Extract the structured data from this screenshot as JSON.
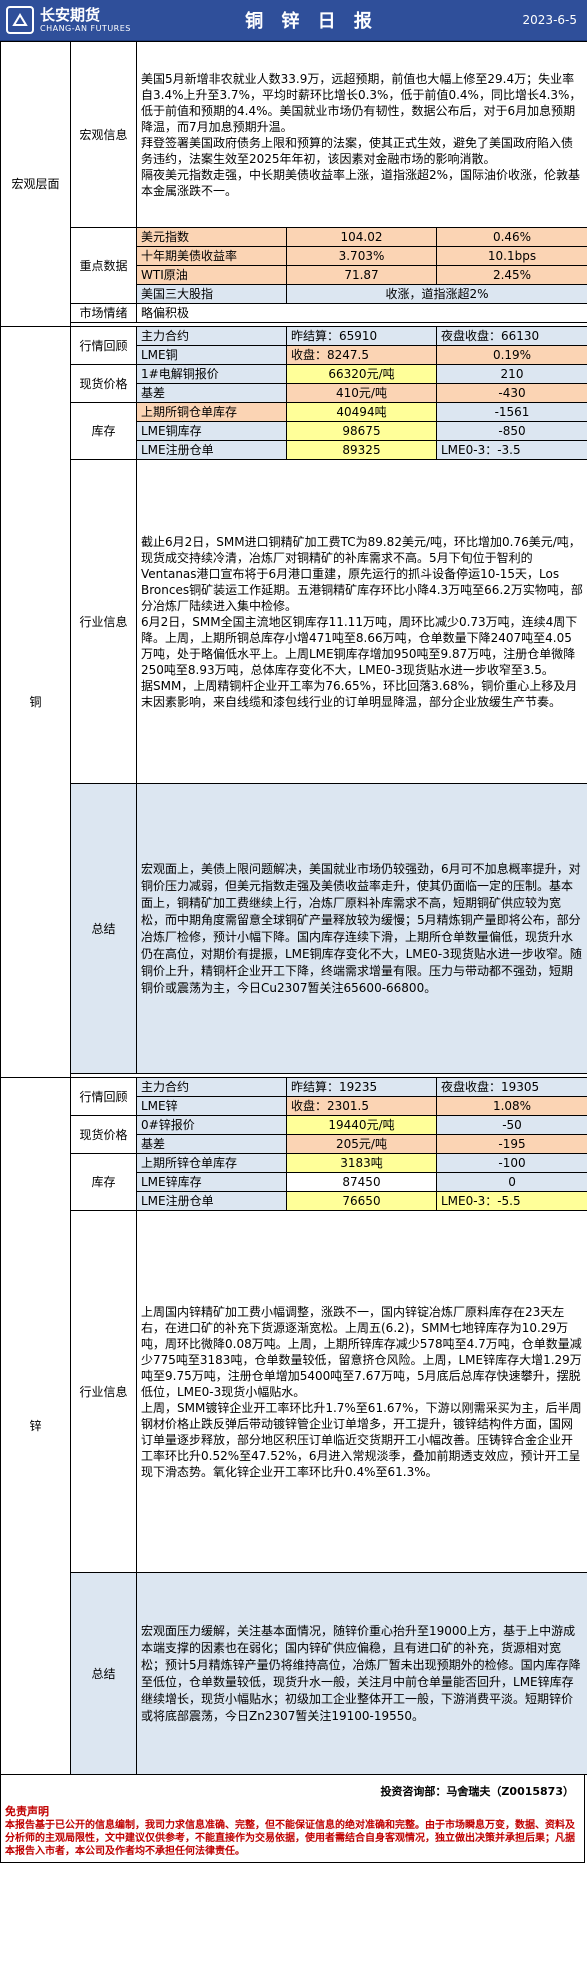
{
  "header": {
    "brand_cn": "长安期货",
    "brand_en": "CHANG-AN FUTURES",
    "title": "铜 锌 日 报",
    "date": "2023-6-5"
  },
  "macro": {
    "section": "宏观层面",
    "info_label": "宏观信息",
    "info_text": "美国5月新增非农就业人数33.9万，远超预期，前值也大幅上修至29.4万；失业率自3.4%上升至3.7%，平均时薪环比增长0.3%，低于前值0.4%，同比增长4.3%，低于前值和预期的4.4%。美国就业市场仍有韧性，数据公布后，对于6月加息预期降温，而7月加息预期升温。\n拜登签署美国政府债务上限和预算的法案，使其正式生效，避免了美国政府陷入债务违约，法案生效至2025年年初，该因素对金融市场的影响消散。\n隔夜美元指数走强，中长期美债收益率上涨，道指涨超2%，国际油价收涨，伦敦基本金属涨跌不一。",
    "data_label": "重点数据",
    "data_rows": [
      {
        "name": "美元指数",
        "value": "104.02",
        "change": "0.46%"
      },
      {
        "name": "十年期美债收益率",
        "value": "3.703%",
        "change": "10.1bps"
      },
      {
        "name": "WTI原油",
        "value": "71.87",
        "change": "2.45%"
      },
      {
        "name": "美国三大股指",
        "value": "收涨，道指涨超2%",
        "change": ""
      }
    ],
    "mood_label": "市场情绪",
    "mood_value": "略偏积极"
  },
  "copper": {
    "section": "铜",
    "market_label": "行情回顾",
    "main_contract": "主力合约",
    "prev_settle": "昨结算：65910",
    "night_close": "夜盘收盘：66130",
    "lme_name": "LME铜",
    "lme_close": "收盘：8247.5",
    "lme_change": "0.19%",
    "spot_label": "现货价格",
    "spot_name": "1#电解铜报价",
    "spot_price": "66320元/吨",
    "spot_change": "210",
    "basis_name": "基差",
    "basis_value": "410元/吨",
    "basis_change": "-430",
    "stock_label": "库存",
    "stock_rows": [
      {
        "name": "上期所铜仓单库存",
        "value": "40494吨",
        "change": "-1561"
      },
      {
        "name": "LME铜库存",
        "value": "98675",
        "change": "-850"
      },
      {
        "name": "LME注册仓单",
        "value": "89325",
        "change": "LME0-3：-3.5"
      }
    ],
    "industry_label": "行业信息",
    "industry_text": "截止6月2日，SMM进口铜精矿加工费TC为89.82美元/吨，环比增加0.76美元/吨，现货成交持续冷清，冶炼厂对铜精矿的补库需求不高。5月下旬位于智利的Ventanas港口宣布将于6月港口重建，原先运行的抓斗设备停运10-15天，Los Bronces铜矿装运工作延期。五港铜精矿库存环比小降4.3万吨至66.2万实物吨，部分冶炼厂陆续进入集中检修。\n6月2日，SMM全国主流地区铜库存11.11万吨，周环比减少0.73万吨，连续4周下降。上周，上期所铜总库存小增471吨至8.66万吨，仓单数量下降2407吨至4.05万吨，处于略偏低水平上。上周LME铜库存增加950吨至9.87万吨，注册仓单微降250吨至8.93万吨，总体库存变化不大，LME0-3现货贴水进一步收窄至3.5。\n据SMM，上周精铜杆企业开工率为76.65%，环比回落3.68%，铜价重心上移及月末因素影响，来自线缆和漆包线行业的订单明显降温，部分企业放缓生产节奏。",
    "summary_label": "总结",
    "summary_text": "宏观面上，美债上限问题解决，美国就业市场仍较强劲，6月可不加息概率提升，对铜价压力减弱，但美元指数走强及美债收益率走升，使其仍面临一定的压制。基本面上，铜精矿加工费继续上行，冶炼厂原料补库需求不高，短期铜矿供应较为宽松，而中期角度需留意全球铜矿产量释放较为缓慢；5月精炼铜产量即将公布，部分冶炼厂检修，预计小幅下降。国内库存连续下滑，上期所仓单数量偏低，现货升水仍在高位，对期价有提振，LME铜库存变化不大，LME0-3现货贴水进一步收窄。随铜价上升，精铜杆企业开工下降，终端需求增量有限。压力与带动都不强劲，短期铜价或震荡为主，今日Cu2307暂关注65600-66800。"
  },
  "zinc": {
    "section": "锌",
    "market_label": "行情回顾",
    "main_contract": "主力合约",
    "prev_settle": "昨结算：19235",
    "night_close": "夜盘收盘：19305",
    "lme_name": "LME锌",
    "lme_close": "收盘：2301.5",
    "lme_change": "1.08%",
    "spot_label": "现货价格",
    "spot_name": "0#锌报价",
    "spot_price": "19440元/吨",
    "spot_change": "-50",
    "basis_name": "基差",
    "basis_value": "205元/吨",
    "basis_change": "-195",
    "stock_label": "库存",
    "stock_rows": [
      {
        "name": "上期所锌仓单库存",
        "value": "3183吨",
        "change": "-100"
      },
      {
        "name": "LME锌库存",
        "value": "87450",
        "change": "0"
      },
      {
        "name": "LME注册仓单",
        "value": "76650",
        "change": "LME0-3：-5.5"
      }
    ],
    "industry_label": "行业信息",
    "industry_text": "上周国内锌精矿加工费小幅调整，涨跌不一，国内锌锭冶炼厂原料库存在23天左右，在进口矿的补充下货源逐渐宽松。上周五(6.2)，SMM七地锌库存为10.29万吨，周环比微降0.08万吨。上周，上期所锌库存减少578吨至4.7万吨，仓单数量减少775吨至3183吨，仓单数量较低，留意挤仓风险。上周，LME锌库存大增1.29万吨至9.75万吨，注册仓单增加5400吨至7.67万吨，5月底后总库存快速攀升，摆脱低位，LME0-3现货小幅贴水。\n上周，SMM镀锌企业开工率环比升1.7%至61.67%，下游以刚需采买为主，后半周钢材价格止跌反弹后带动镀锌管企业订单增多，开工提升，镀锌结构件方面，国网订单量逐步释放，部分地区积压订单临近交货期开工小幅改善。压铸锌合金企业开工率环比升0.52%至47.52%，6月进入常规淡季，叠加前期透支效应，预计开工呈现下滑态势。氧化锌企业开工率环比升0.4%至61.3%。",
    "summary_label": "总结",
    "summary_text": "宏观面压力缓解，关注基本面情况，随锌价重心抬升至19000上方，基于上中游成本端支撑的因素也在弱化；国内锌矿供应偏稳，且有进口矿的补充，货源相对宽松；预计5月精炼锌产量仍将维持高位，冶炼厂暂未出现预期外的检修。国内库存降至低位，仓单数量较低，现货升水一般，关注月中前仓单量能否回升，LME锌库存继续增长，现货小幅贴水；初级加工企业整体开工一般，下游消费平淡。短期锌价或将底部震荡，今日Zn2307暂关注19100-19550。"
  },
  "footer": {
    "analyst": "投资咨询部：马舍瑞夫（Z0015873）",
    "disclaimer_title": "免责声明",
    "disclaimer_text": "本报告基于已公开的信息编制，我司力求信息准确、完整，但不能保证信息的绝对准确和完整。由于市场瞬息万变，数据、资料及分析师的主观局限性，文中建议仅供参考，不能直接作为交易依据，使用者需结合自身客观情况，独立做出决策并承担后果；凡据本报告入市者，本公司及作者均不承担任何法律责任。"
  }
}
